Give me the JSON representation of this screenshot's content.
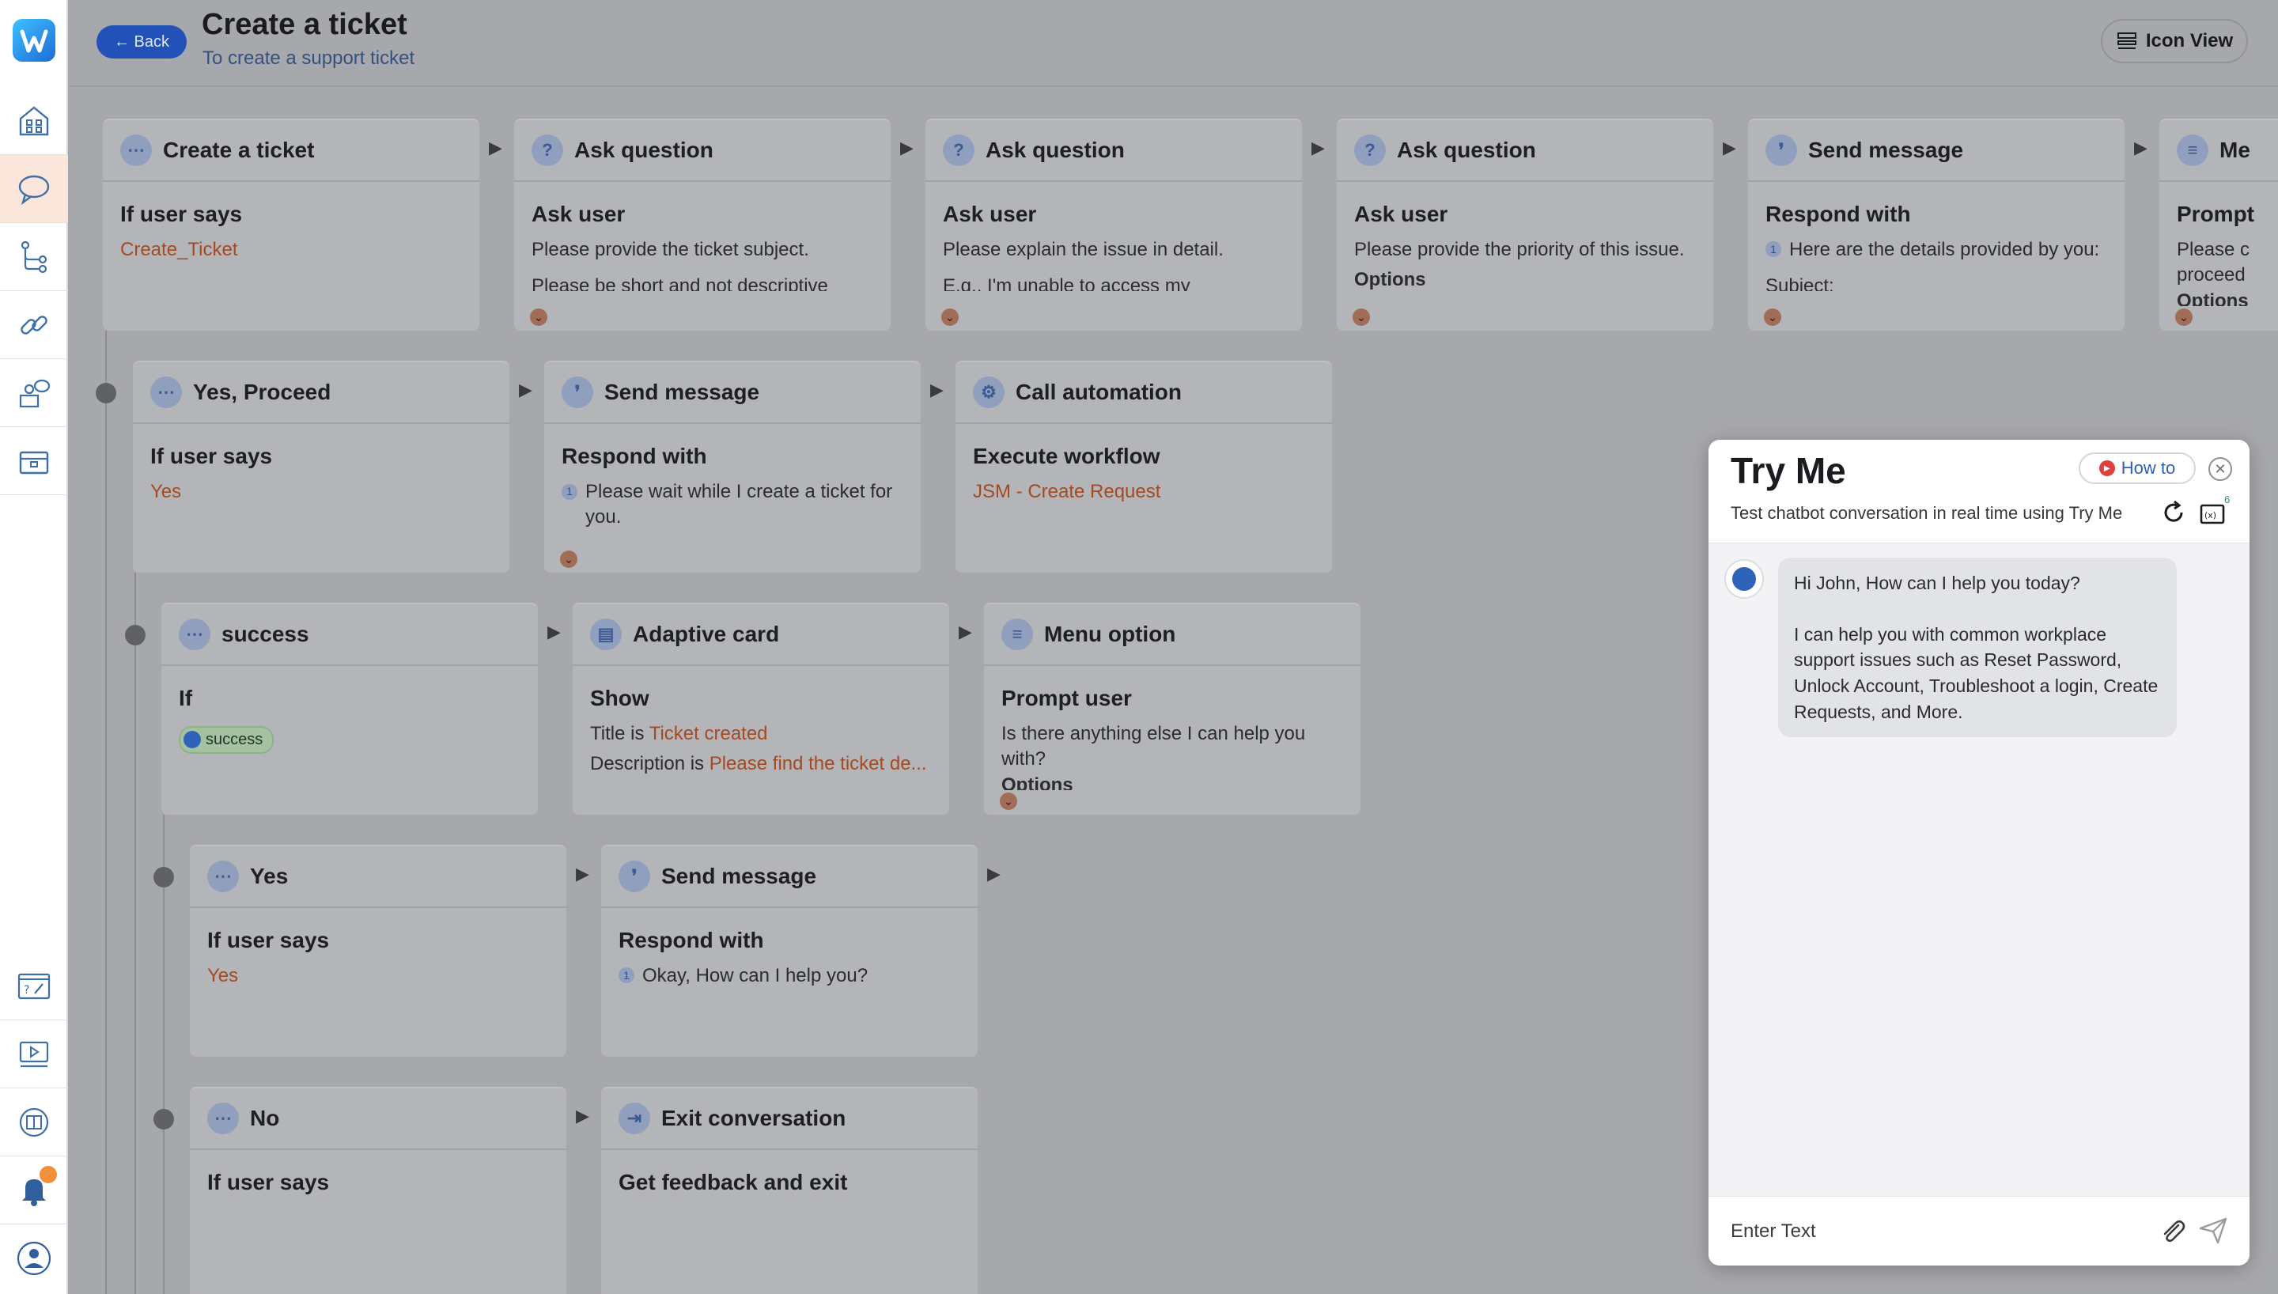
{
  "sidebar": {
    "logo_icon": "w-logo-icon",
    "items": [
      {
        "icon": "home-icon"
      },
      {
        "icon": "chat-bubble-icon",
        "active": true
      },
      {
        "icon": "workflow-branch-icon"
      },
      {
        "icon": "link-icon"
      },
      {
        "icon": "agent-desk-icon"
      },
      {
        "icon": "briefcase-icon"
      }
    ],
    "bottom_items": [
      {
        "icon": "faq-edit-icon"
      },
      {
        "icon": "video-play-icon"
      },
      {
        "icon": "knowledge-icon"
      },
      {
        "icon": "bell-icon",
        "has_notification": true
      },
      {
        "icon": "user-avatar-icon"
      }
    ]
  },
  "header": {
    "back_label": "← Back",
    "title": "Create a ticket",
    "subtitle": "To create a support ticket",
    "icon_view_label": "Icon View"
  },
  "flow": {
    "row1": [
      {
        "title": "Create a ticket",
        "icon": "chat-icon",
        "label": "If user says",
        "value": "Create_Ticket"
      },
      {
        "title": "Ask question",
        "icon": "question-icon",
        "label": "Ask user",
        "line1": "Please provide the ticket subject.",
        "line2": "Please be short and not descriptive"
      },
      {
        "title": "Ask question",
        "icon": "question-icon",
        "label": "Ask user",
        "line1": "Please explain the issue in detail.",
        "line2": "E.g., I'm unable to access my"
      },
      {
        "title": "Ask question",
        "icon": "question-icon",
        "label": "Ask user",
        "line1": "Please provide the priority of this issue.",
        "line2": "Options"
      },
      {
        "title": "Send message",
        "icon": "message-icon",
        "label": "Respond with",
        "line1": "Here are the details provided by you:",
        "line2": "Subject:"
      },
      {
        "title": "Me",
        "icon": "menu-icon",
        "label": "Prompt",
        "line1": "Please c",
        "line2": "proceed",
        "line3": "Options"
      }
    ],
    "row2": [
      {
        "title": "Yes, Proceed",
        "icon": "chat-icon",
        "label": "If user says",
        "value": "Yes"
      },
      {
        "title": "Send message",
        "icon": "message-icon",
        "label": "Respond with",
        "line1": "Please wait while I create a ticket for you."
      },
      {
        "title": "Call automation",
        "icon": "automation-icon",
        "label": "Execute workflow",
        "value": "JSM - Create Request"
      }
    ],
    "row3": [
      {
        "title": "success",
        "icon": "chat-icon",
        "label": "If",
        "badge": "success"
      },
      {
        "title": "Adaptive card",
        "icon": "card-icon",
        "label": "Show",
        "title_prefix": "Title is",
        "title_value": "Ticket created",
        "desc_prefix": "Description is",
        "desc_value": "Please find the ticket de..."
      },
      {
        "title": "Menu option",
        "icon": "menu-icon",
        "label": "Prompt user",
        "line1": "Is there anything else I can help you with?",
        "line2": "Options"
      }
    ],
    "row4": [
      {
        "title": "Yes",
        "icon": "chat-icon",
        "label": "If user says",
        "value": "Yes"
      },
      {
        "title": "Send message",
        "icon": "message-icon",
        "label": "Respond with",
        "line1": "Okay, How can I help you?"
      }
    ],
    "row5": [
      {
        "title": "No",
        "icon": "chat-icon",
        "label": "If user says"
      },
      {
        "title": "Exit conversation",
        "icon": "exit-icon",
        "label": "Get feedback and exit"
      }
    ]
  },
  "tryme": {
    "title": "Try Me",
    "how_to_label": "How to",
    "subtitle": "Test chatbot conversation in real time using Try Me",
    "variable_badge": "6",
    "messages": [
      {
        "from": "bot",
        "greeting": "Hi John, How can I help you today?",
        "text": "I can help you with common workplace support issues such as Reset Password, Unlock Account, Troubleshoot a login, Create Requests, and More."
      }
    ],
    "input_placeholder": "Enter Text"
  }
}
